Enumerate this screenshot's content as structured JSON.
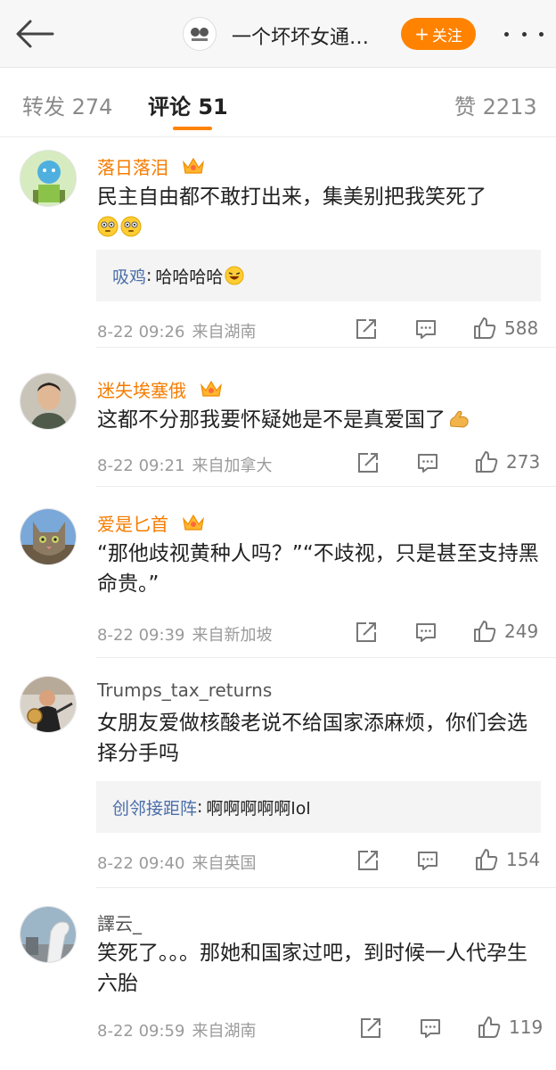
{
  "header": {
    "back_icon": "back-arrow-icon",
    "title": "一个坏坏女通…",
    "follow_label": "关注",
    "follow_plus": "+",
    "follow_color": "#ff8200",
    "more_icon": "more-dots-icon"
  },
  "tabs": {
    "repost": "转发 274",
    "comment": "评论 51",
    "like": "赞 2213",
    "active_color": "#ff8200"
  },
  "comments": [
    {
      "username": "落日落泪",
      "text": "民主自由都不敢打出来，集美别把我笑死了",
      "reply_name": "吸鸡",
      "reply_sep": ":",
      "reply_text": "哈哈哈哈",
      "time": "8-22 09:26",
      "source": "来自湖南",
      "likes": "588"
    },
    {
      "username": "迷失埃塞俄",
      "text": "这都不分那我要怀疑她是不是真爱国了",
      "time": "8-22 09:21",
      "source": "来自加拿大",
      "likes": "273"
    },
    {
      "username": "爱是匕首",
      "text": "“那他歧视黄种人吗？”“不歧视，只是甚至支持黑命贵。”",
      "time": "8-22 09:39",
      "source": "来自新加坡",
      "likes": "249"
    },
    {
      "username": "Trumps_tax_returns",
      "text": "女朋友爱做核酸老说不给国家添麻烦，你们会选择分手吗",
      "reply_name": "创邻接距阵",
      "reply_sep": ":",
      "reply_text": "啊啊啊啊啊lol",
      "time": "8-22 09:40",
      "source": "来自英国",
      "likes": "154"
    },
    {
      "username": "譯云_",
      "text": "笑死了。。。那她和国家过吧，到时候一人代孕生六胎",
      "time": "8-22 09:59",
      "source": "来自湖南",
      "likes": "119"
    }
  ],
  "colors": {
    "vip_name": "#f57c00",
    "reply_name": "#4a6ea9",
    "meta": "#9a9a9a"
  }
}
